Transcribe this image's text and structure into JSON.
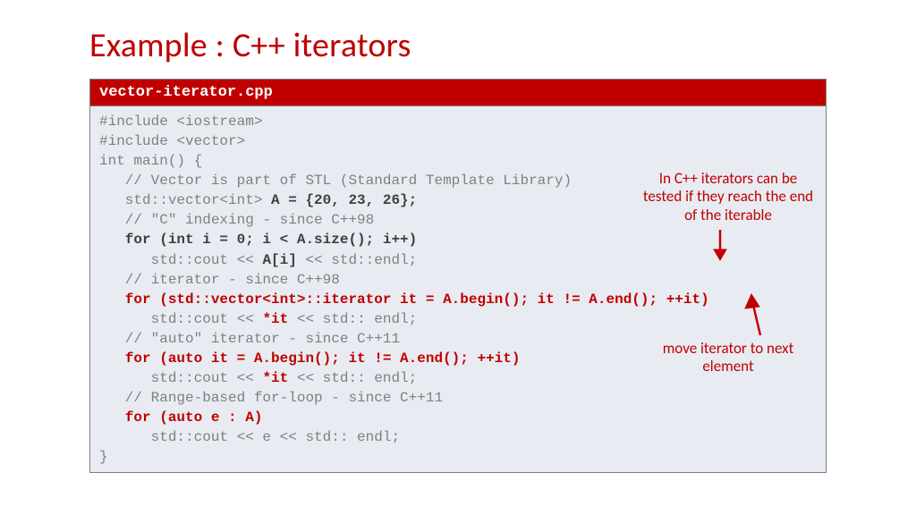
{
  "title": "Example : C++ iterators",
  "filename": "vector-iterator.cpp",
  "code": {
    "l1": "#include <iostream>",
    "l2": "#include <vector>",
    "l3": "int main() {",
    "l4": "   // Vector is part of STL (Standard Template Library)",
    "l5a": "   std::vector<int> ",
    "l5b": "A = {20, 23, 26};",
    "l6": "   // \"C\" indexing - since C++98",
    "l7": "   for (int i = 0; i < A.size(); i++)",
    "l8a": "      std::cout << ",
    "l8b": "A[i]",
    "l8c": " << std::endl;",
    "l9": "   // iterator - since C++98",
    "l10": "   for (std::vector<int>::iterator it = A.begin(); it != A.end(); ++it)",
    "l11a": "      std::cout << ",
    "l11b": "*it",
    "l11c": " << std:: endl;",
    "l12": "   // \"auto\" iterator - since C++11",
    "l13": "   for (auto it = A.begin(); it != A.end(); ++it)",
    "l14a": "      std::cout << ",
    "l14b": "*it",
    "l14c": " << std:: endl;",
    "l15": "   // Range-based for-loop - since C++11",
    "l16": "   for (auto e : A)",
    "l17": "      std::cout << e << std:: endl;",
    "l18": "}"
  },
  "notes": {
    "n1": "In C++ iterators can be tested if they reach the end of the iterable",
    "n2": "move iterator to next element"
  }
}
